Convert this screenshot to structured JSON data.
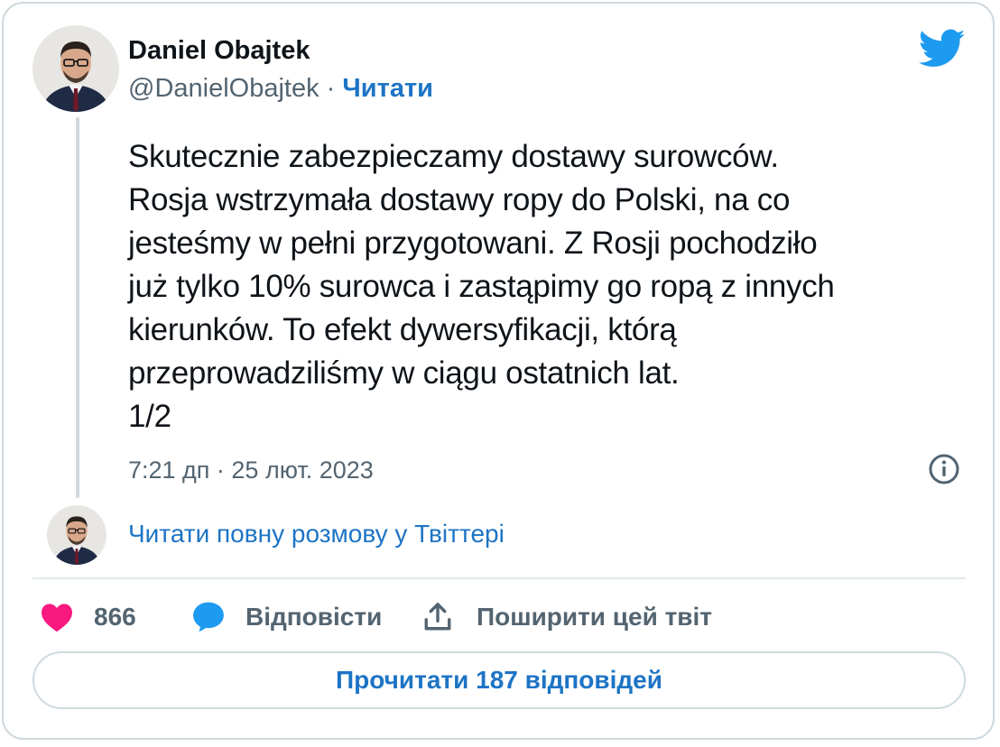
{
  "author": {
    "name": "Daniel Obajtek",
    "handle": "@DanielObajtek",
    "separator": "·",
    "follow_label": "Читати"
  },
  "tweet": {
    "text": "Skutecznie zabezpieczamy dostawy surowców.\nRosja wstrzymała dostawy ropy do Polski, na co\njesteśmy w pełni przygotowani. Z Rosji pochodziło\njuż tylko 10% surowca i zastąpimy go ropą z innych\nkierunków. To efekt dywersyfikacji, którą\nprzeprowadziliśmy w ciągu ostatnich lat.\n1/2",
    "timestamp": "7:21 дп · 25 лют. 2023"
  },
  "conversation": {
    "read_full_label": "Читати повну розмову у Твіттері"
  },
  "actions": {
    "like_count": "866",
    "reply_label": "Відповісти",
    "share_label": "Поширити цей твіт"
  },
  "footer": {
    "read_replies_label": "Прочитати 187 відповідей"
  },
  "icons": {
    "logo": "twitter-bird-icon",
    "info": "info-circle-icon",
    "like": "heart-icon",
    "reply": "speech-bubble-icon",
    "share": "share-upload-icon"
  },
  "colors": {
    "link": "#1d74c5",
    "twitter_blue": "#1d9bf0",
    "like_pink": "#f91880",
    "text": "#0f1419",
    "muted": "#536471",
    "border": "#cfd9de"
  }
}
